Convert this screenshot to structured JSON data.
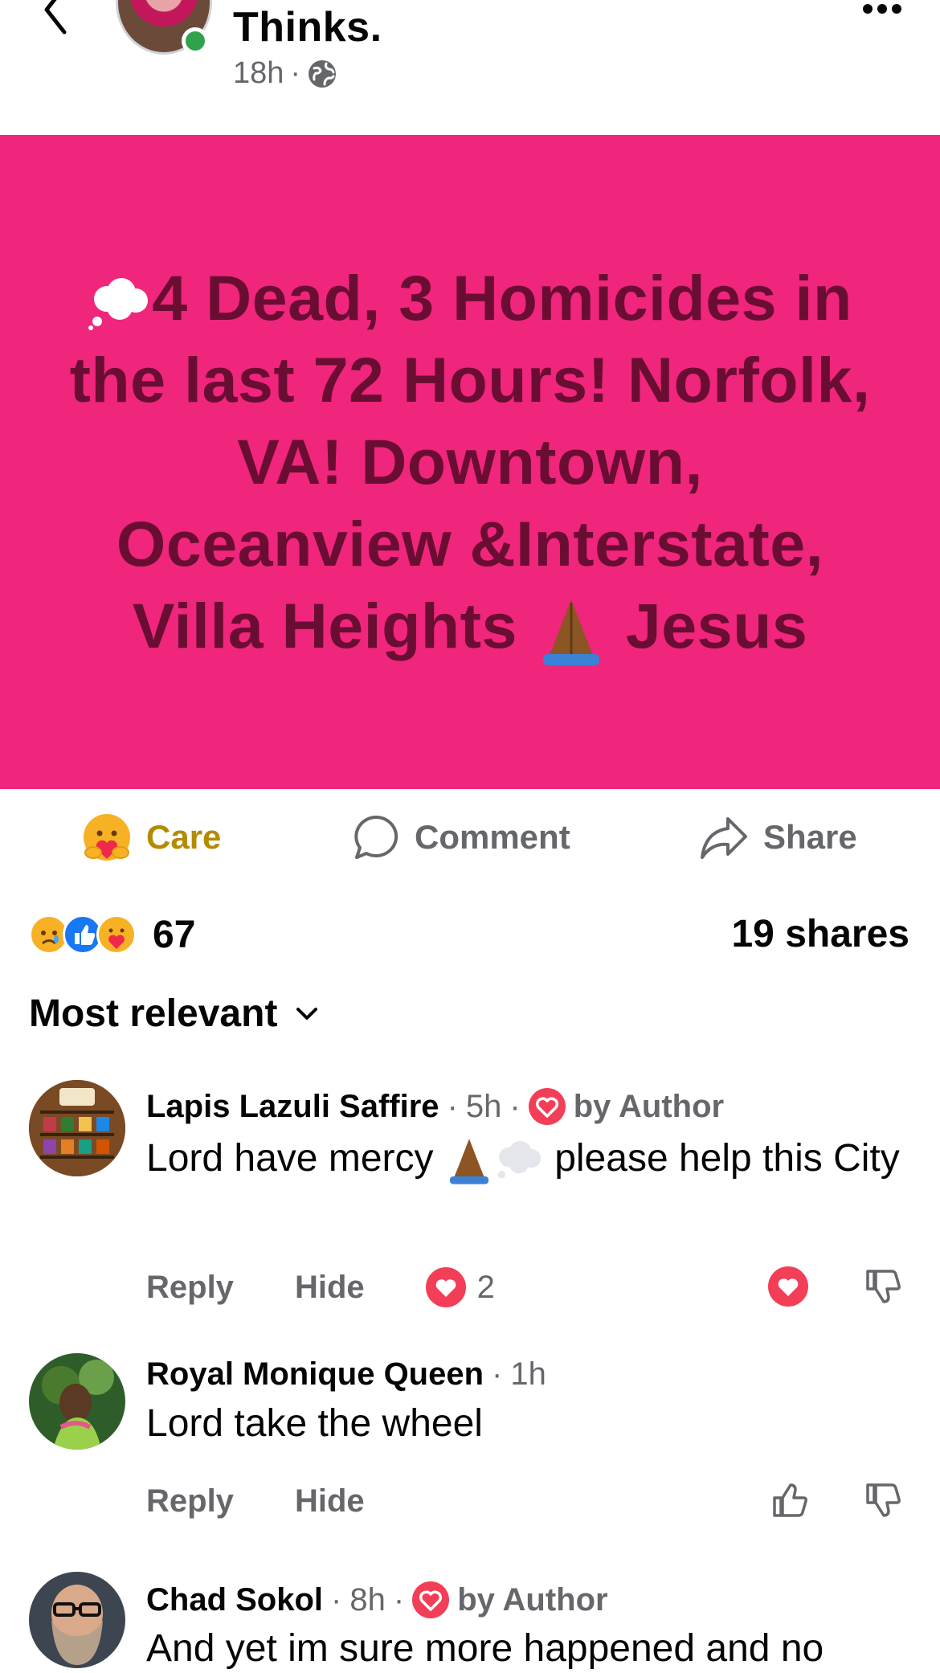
{
  "header": {
    "page_name": "Thinks.",
    "post_time": "18h",
    "separator": "·"
  },
  "post": {
    "text": "4 Dead, 3 Homicides in the last 72 Hours! Norfolk, VA! Downtown, Oceanview &Interstate, Villa Heights",
    "text_end": "Jesus",
    "background_color": "#f0257c",
    "text_color": "#6a0d32"
  },
  "actions": {
    "care_label": "Care",
    "comment_label": "Comment",
    "share_label": "Share"
  },
  "summary": {
    "reaction_count": "67",
    "shares": "19 shares",
    "reactions": [
      "sad",
      "like",
      "care"
    ]
  },
  "comments_sort": {
    "label": "Most relevant"
  },
  "comments": [
    {
      "author": "Lapis Lazuli Saffire",
      "time": "5h",
      "author_badge": "by Author",
      "text_a": "Lord have mercy",
      "text_b": "please help this City",
      "reply": "Reply",
      "hide": "Hide",
      "reaction_count": "2"
    },
    {
      "author": "Royal Monique Queen",
      "time": "1h",
      "text": "Lord take the wheel",
      "reply": "Reply",
      "hide": "Hide"
    },
    {
      "author": "Chad Sokol",
      "time": "8h",
      "author_badge": "by Author",
      "text": "And yet im sure more happened and no"
    }
  ],
  "colors": {
    "care_text": "#b38b00",
    "meta_gray": "#65676b",
    "heart_red": "#f33e58",
    "online_green": "#31a24c"
  }
}
